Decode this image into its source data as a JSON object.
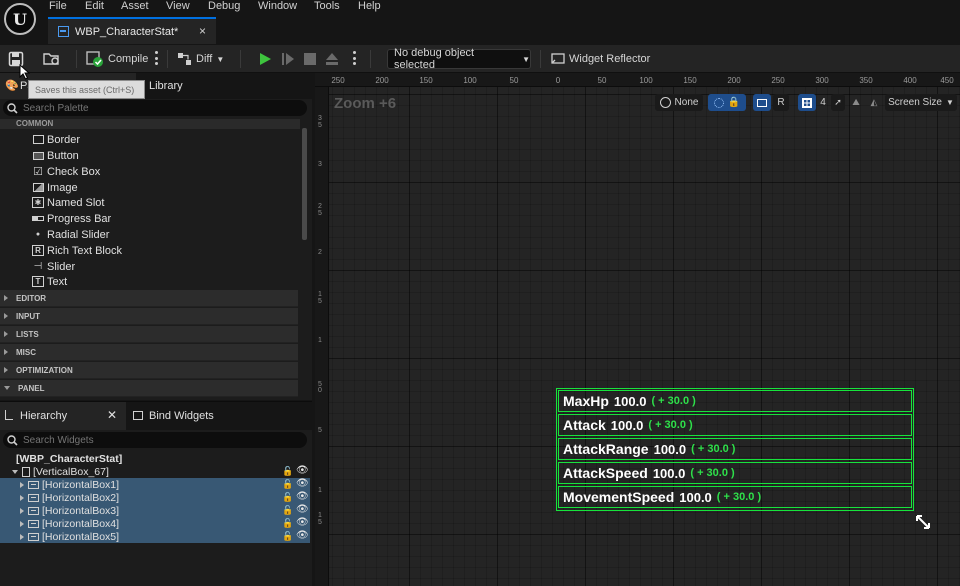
{
  "menu": [
    "File",
    "Edit",
    "Asset",
    "View",
    "Debug",
    "Window",
    "Tools",
    "Help"
  ],
  "tab": {
    "title": "WBP_CharacterStat*",
    "close": "×"
  },
  "toolbar": {
    "compile_label": "Compile",
    "diff_label": "Diff",
    "debug_object": "No debug object selected",
    "widget_reflector": "Widget Reflector"
  },
  "tooltip": "Saves this asset (Ctrl+S)",
  "palette": {
    "tab_palette": "Palette",
    "tab_library": "Library",
    "search_placeholder": "Search Palette",
    "common_header": "COMMON",
    "items": [
      {
        "label": "Border",
        "icon": "border-icon"
      },
      {
        "label": "Button",
        "icon": "button-icon"
      },
      {
        "label": "Check Box",
        "icon": "checkbox-icon"
      },
      {
        "label": "Image",
        "icon": "image-icon"
      },
      {
        "label": "Named Slot",
        "icon": "named-slot-icon"
      },
      {
        "label": "Progress Bar",
        "icon": "progress-bar-icon"
      },
      {
        "label": "Radial Slider",
        "icon": "radial-slider-icon"
      },
      {
        "label": "Rich Text Block",
        "icon": "rich-text-icon"
      },
      {
        "label": "Slider",
        "icon": "slider-icon"
      },
      {
        "label": "Text",
        "icon": "text-icon"
      }
    ],
    "categories": [
      "EDITOR",
      "INPUT",
      "LISTS",
      "MISC",
      "OPTIMIZATION",
      "PANEL"
    ]
  },
  "hierarchy": {
    "tab_hierarchy": "Hierarchy",
    "tab_bind": "Bind Widgets",
    "search_placeholder": "Search Widgets",
    "root": "[WBP_CharacterStat]",
    "vbox": "[VerticalBox_67]",
    "children": [
      "[HorizontalBox1]",
      "[HorizontalBox2]",
      "[HorizontalBox3]",
      "[HorizontalBox4]",
      "[HorizontalBox5]"
    ]
  },
  "viewport": {
    "zoom": "Zoom +6",
    "none_label": "None",
    "r_label": "R",
    "grid_count": "4",
    "screen_size": "Screen Size",
    "ruler_h": [
      "250",
      "200",
      "150",
      "100",
      "50",
      "0",
      "50",
      "100",
      "150",
      "200",
      "250",
      "300",
      "350",
      "400",
      "450"
    ],
    "ruler_v": [
      "3\n5",
      "3",
      "2\n5",
      "2",
      "1\n5",
      "1",
      "5",
      "0",
      "5",
      "1",
      "1\n5"
    ]
  },
  "stats": [
    {
      "name": "MaxHp",
      "value": "100.0",
      "bonus": "( + 30.0 )"
    },
    {
      "name": "Attack",
      "value": "100.0",
      "bonus": "( + 30.0 )"
    },
    {
      "name": "AttackRange",
      "value": "100.0",
      "bonus": "( + 30.0 )"
    },
    {
      "name": "AttackSpeed",
      "value": "100.0",
      "bonus": "( + 30.0 )"
    },
    {
      "name": "MovementSpeed",
      "value": "100.0",
      "bonus": "( + 30.0 )"
    }
  ],
  "colors": {
    "accent": "#0070e0",
    "widget_outline": "#17e33c",
    "bonus_text": "#2ee04a",
    "selection": "#385874"
  }
}
